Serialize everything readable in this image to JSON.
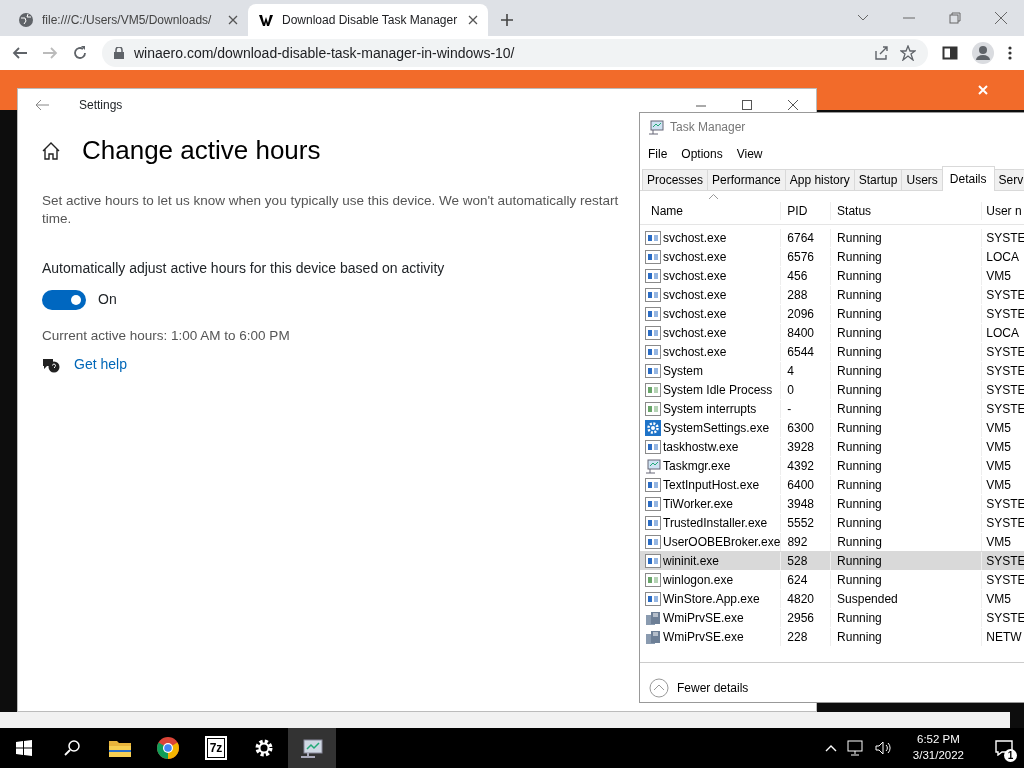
{
  "browser": {
    "tabs": [
      {
        "title": "file:///C:/Users/VM5/Downloads/",
        "selected": false
      },
      {
        "title": "Download Disable Task Manager",
        "selected": true
      }
    ],
    "url": "winaero.com/download-disable-task-manager-in-windows-10/"
  },
  "settings": {
    "title": "Settings",
    "heading": "Change active hours",
    "description_lines": [
      "Set active hours to let us know when you typically use this device. We won't automatically restart",
      "time."
    ],
    "toggle": {
      "label": "Automatically adjust active hours for this device based on activity",
      "on": true,
      "state_text": "On"
    },
    "current_hours": "Current active hours: 1:00 AM to 6:00 PM",
    "help_link": "Get help"
  },
  "task_manager": {
    "title": "Task Manager",
    "menu": [
      "File",
      "Options",
      "View"
    ],
    "tabs": [
      {
        "label": "Processes",
        "selected": false
      },
      {
        "label": "Performance",
        "selected": false
      },
      {
        "label": "App history",
        "selected": false
      },
      {
        "label": "Startup",
        "selected": false
      },
      {
        "label": "Users",
        "selected": false
      },
      {
        "label": "Details",
        "selected": true
      },
      {
        "label": "Serv",
        "selected": false
      }
    ],
    "columns": [
      "Name",
      "PID",
      "Status",
      "User n"
    ],
    "rows": [
      {
        "kind": "app",
        "name": "svchost.exe",
        "pid": "6764",
        "status": "Running",
        "user": "SYSTE",
        "selected": false
      },
      {
        "kind": "app",
        "name": "svchost.exe",
        "pid": "6576",
        "status": "Running",
        "user": "LOCA",
        "selected": false
      },
      {
        "kind": "app",
        "name": "svchost.exe",
        "pid": "456",
        "status": "Running",
        "user": "VM5",
        "selected": false
      },
      {
        "kind": "app",
        "name": "svchost.exe",
        "pid": "288",
        "status": "Running",
        "user": "SYSTE",
        "selected": false
      },
      {
        "kind": "app",
        "name": "svchost.exe",
        "pid": "2096",
        "status": "Running",
        "user": "SYSTE",
        "selected": false
      },
      {
        "kind": "app",
        "name": "svchost.exe",
        "pid": "8400",
        "status": "Running",
        "user": "LOCA",
        "selected": false
      },
      {
        "kind": "app",
        "name": "svchost.exe",
        "pid": "6544",
        "status": "Running",
        "user": "SYSTE",
        "selected": false
      },
      {
        "kind": "app",
        "name": "System",
        "pid": "4",
        "status": "Running",
        "user": "SYSTE",
        "selected": false
      },
      {
        "kind": "sys",
        "name": "System Idle Process",
        "pid": "0",
        "status": "Running",
        "user": "SYSTE",
        "selected": false
      },
      {
        "kind": "sys",
        "name": "System interrupts",
        "pid": "-",
        "status": "Running",
        "user": "SYSTE",
        "selected": false
      },
      {
        "kind": "gear",
        "name": "SystemSettings.exe",
        "pid": "6300",
        "status": "Running",
        "user": "VM5",
        "selected": false
      },
      {
        "kind": "app",
        "name": "taskhostw.exe",
        "pid": "3928",
        "status": "Running",
        "user": "VM5",
        "selected": false
      },
      {
        "kind": "monitor",
        "name": "Taskmgr.exe",
        "pid": "4392",
        "status": "Running",
        "user": "VM5",
        "selected": false
      },
      {
        "kind": "app",
        "name": "TextInputHost.exe",
        "pid": "6400",
        "status": "Running",
        "user": "VM5",
        "selected": false
      },
      {
        "kind": "app",
        "name": "TiWorker.exe",
        "pid": "3948",
        "status": "Running",
        "user": "SYSTE",
        "selected": false
      },
      {
        "kind": "app",
        "name": "TrustedInstaller.exe",
        "pid": "5552",
        "status": "Running",
        "user": "SYSTE",
        "selected": false
      },
      {
        "kind": "app",
        "name": "UserOOBEBroker.exe",
        "pid": "892",
        "status": "Running",
        "user": "VM5",
        "selected": false
      },
      {
        "kind": "app",
        "name": "wininit.exe",
        "pid": "528",
        "status": "Running",
        "user": "SYSTE",
        "selected": true
      },
      {
        "kind": "sys",
        "name": "winlogon.exe",
        "pid": "624",
        "status": "Running",
        "user": "SYSTE",
        "selected": false
      },
      {
        "kind": "app",
        "name": "WinStore.App.exe",
        "pid": "4820",
        "status": "Suspended",
        "user": "VM5",
        "selected": false
      },
      {
        "kind": "wmi",
        "name": "WmiPrvSE.exe",
        "pid": "2956",
        "status": "Running",
        "user": "SYSTE",
        "selected": false
      },
      {
        "kind": "wmi",
        "name": "WmiPrvSE.exe",
        "pid": "228",
        "status": "Running",
        "user": "NETW",
        "selected": false
      }
    ],
    "footer": "Fewer details"
  },
  "taskbar": {
    "apps": [
      {
        "kind": "folder",
        "active": false
      },
      {
        "kind": "chrome",
        "active": false
      },
      {
        "kind": "archiver",
        "label": "7z",
        "active": false
      },
      {
        "kind": "gear",
        "active": false
      },
      {
        "kind": "monitor",
        "active": true
      }
    ],
    "time": "6:52 PM",
    "date": "3/31/2022",
    "notification_count": "1"
  }
}
